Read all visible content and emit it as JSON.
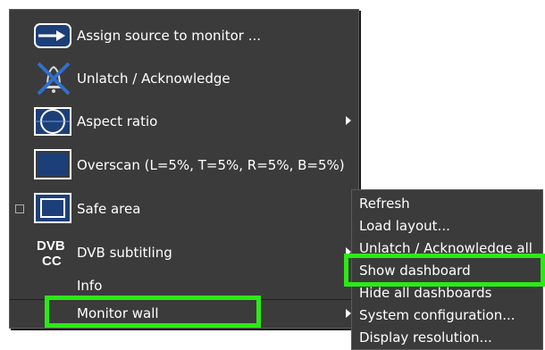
{
  "menu": {
    "items": [
      {
        "label": "Assign source to monitor ...",
        "icon": "assign-source-icon"
      },
      {
        "label": "Unlatch / Acknowledge",
        "icon": "unlatch-bell-icon"
      },
      {
        "label": "Aspect ratio",
        "icon": "aspect-ratio-icon",
        "submenu": true
      },
      {
        "label": "Overscan (L=5%, T=5%, R=5%, B=5%)",
        "icon": "overscan-icon"
      },
      {
        "label": "Safe area",
        "icon": "safe-area-icon",
        "checkbox": true
      },
      {
        "label": "DVB subtitling",
        "icon": "dvb-cc-icon",
        "submenu": true
      },
      {
        "label": "Info"
      },
      {
        "label": "Monitor wall",
        "submenu": true,
        "highlighted": true
      }
    ],
    "dvb_icon_text": {
      "top": "DVB",
      "bottom": "CC"
    }
  },
  "submenu": {
    "items": [
      {
        "label": "Refresh"
      },
      {
        "label": "Load layout..."
      },
      {
        "label": "Unlatch / Acknowledge all"
      },
      {
        "label": "Show dashboard",
        "highlighted": true
      },
      {
        "label": "Hide all dashboards"
      },
      {
        "label": "System configuration..."
      },
      {
        "label": "Display resolution..."
      }
    ]
  },
  "colors": {
    "menu_bg": "#3b3b3b",
    "text": "#ffffff",
    "highlight": "#2bea14",
    "icon_blue": "#2f6fd0"
  }
}
